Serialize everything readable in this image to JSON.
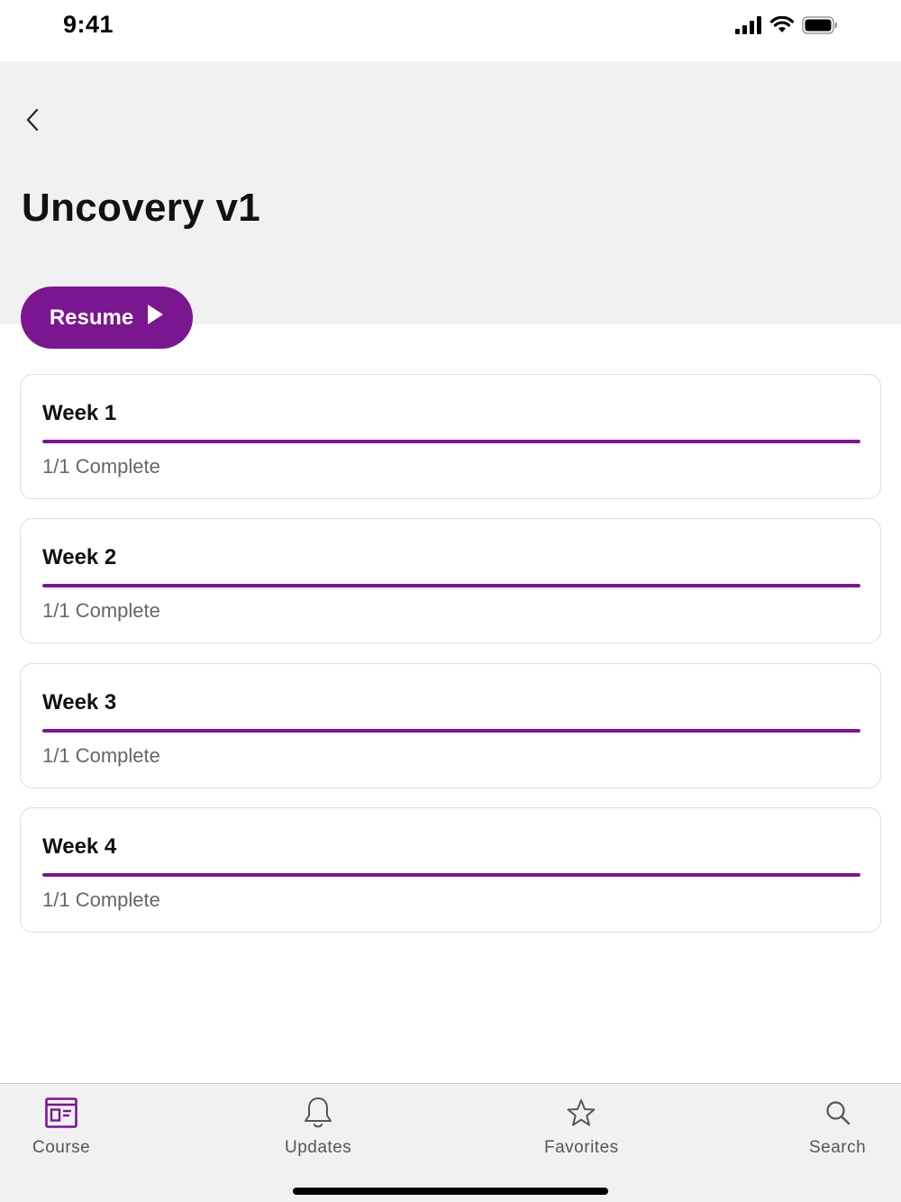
{
  "status_bar": {
    "time": "9:41",
    "icons": [
      "cellular-signal-icon",
      "wifi-icon",
      "battery-icon"
    ]
  },
  "header": {
    "back_icon": "chevron-left-icon",
    "title": "Uncovery v1"
  },
  "resume_button": {
    "label": "Resume",
    "icon": "play-icon"
  },
  "weeks": [
    {
      "title": "Week 1",
      "status": "1/1 Complete",
      "progress": 1.0
    },
    {
      "title": "Week 2",
      "status": "1/1 Complete",
      "progress": 1.0
    },
    {
      "title": "Week 3",
      "status": "1/1 Complete",
      "progress": 1.0
    },
    {
      "title": "Week 4",
      "status": "1/1 Complete",
      "progress": 1.0
    }
  ],
  "tab_bar": {
    "tabs": [
      {
        "label": "Course",
        "icon": "course-icon",
        "active": true
      },
      {
        "label": "Updates",
        "icon": "bell-icon",
        "active": false
      },
      {
        "label": "Favorites",
        "icon": "star-icon",
        "active": false
      },
      {
        "label": "Search",
        "icon": "search-icon",
        "active": false
      }
    ]
  },
  "colors": {
    "accent": "#7b1691",
    "header_background": "#f1f1f1",
    "card_border": "#dddddd",
    "muted_text": "#666666"
  }
}
